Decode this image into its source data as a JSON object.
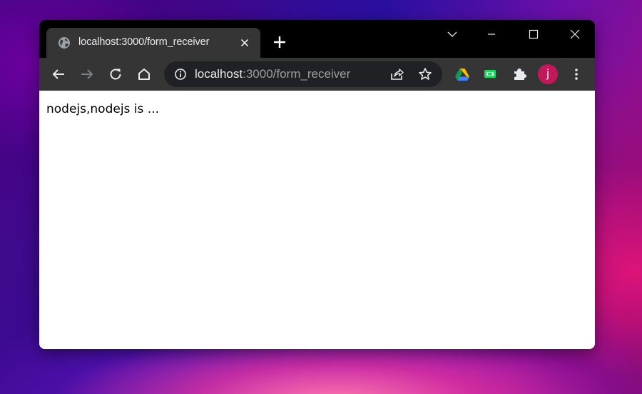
{
  "tab": {
    "title": "localhost:3000/form_receiver",
    "favicon_icon": "globe-icon",
    "close_icon": "close-icon"
  },
  "window_controls": {
    "tab_search_icon": "chevron-down-icon",
    "minimize_icon": "minimize-icon",
    "maximize_icon": "maximize-icon",
    "close_icon": "close-icon"
  },
  "toolbar": {
    "back_icon": "arrow-left-icon",
    "forward_icon": "arrow-right-icon",
    "reload_icon": "reload-icon",
    "home_icon": "home-icon",
    "omnibox": {
      "host": "localhost",
      "path": ":3000/form_receiver",
      "info_icon": "info-icon",
      "share_icon": "share-icon",
      "bookmark_icon": "star-icon"
    },
    "extensions": [
      {
        "icon": "google-drive-icon"
      },
      {
        "icon": "green-extension-icon"
      },
      {
        "icon": "puzzle-icon"
      }
    ],
    "profile_initial": "j",
    "menu_icon": "kebab-menu-icon"
  },
  "page": {
    "text": "nodejs,nodejs is ..."
  },
  "colors": {
    "titlebar": "#000000",
    "tab_active": "#353535",
    "toolbar": "#353535",
    "omnibox": "#202124",
    "avatar": "#c2185b"
  }
}
